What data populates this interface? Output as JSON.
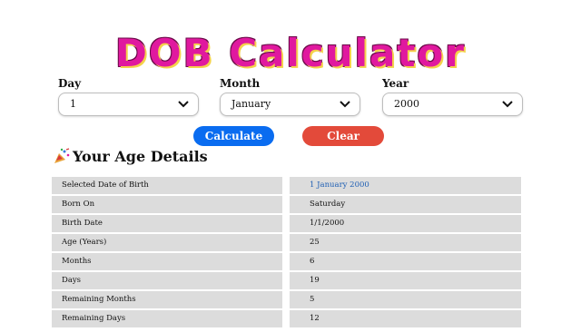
{
  "app": {
    "title": "DOB Calculator"
  },
  "form": {
    "day": {
      "label": "Day",
      "value": "1"
    },
    "month": {
      "label": "Month",
      "value": "January"
    },
    "year": {
      "label": "Year",
      "value": "2000"
    }
  },
  "buttons": {
    "calculate": "Calculate",
    "clear": "Clear"
  },
  "details": {
    "icon": "party-popper-icon",
    "title": "Your Age Details",
    "rows": [
      {
        "label": "Selected Date of Birth",
        "value": "1 January 2000"
      },
      {
        "label": "Born On",
        "value": "Saturday"
      },
      {
        "label": "Birth Date",
        "value": "1/1/2000"
      },
      {
        "label": "Age (Years)",
        "value": "25"
      },
      {
        "label": "Months",
        "value": "6"
      },
      {
        "label": "Days",
        "value": "19"
      },
      {
        "label": "Remaining Months",
        "value": "5"
      },
      {
        "label": "Remaining Days",
        "value": "12"
      }
    ]
  },
  "colors": {
    "title": "#e0199f",
    "calculate": "#0a6cf0",
    "clear": "#e34a3a",
    "row_bg": "#dcdcdc",
    "accent_value": "#1f5fb4"
  }
}
